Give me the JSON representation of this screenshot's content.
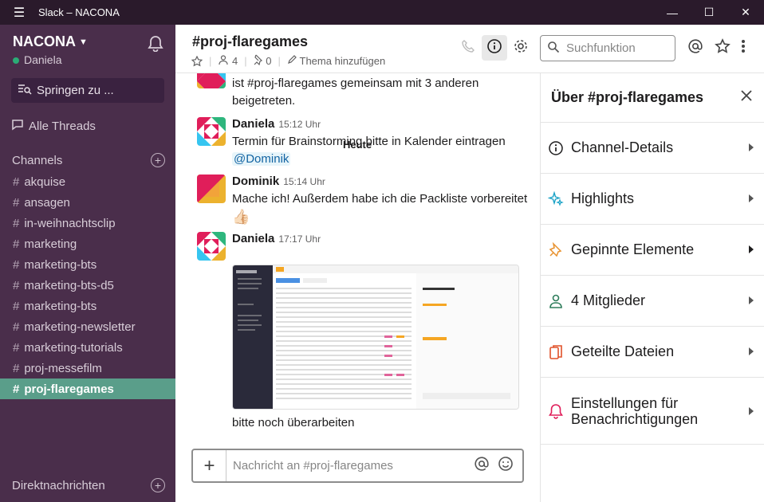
{
  "window": {
    "title": "Slack – NACONA"
  },
  "workspace": {
    "name": "NACONA",
    "user": "Daniela"
  },
  "sidebar": {
    "jump_label": "Springen zu ...",
    "threads_label": "Alle Threads",
    "channels_header": "Channels",
    "channels": [
      {
        "name": "akquise"
      },
      {
        "name": "ansagen"
      },
      {
        "name": "in-weihnachtsclip"
      },
      {
        "name": "marketing"
      },
      {
        "name": "marketing-bts"
      },
      {
        "name": "marketing-bts-d5"
      },
      {
        "name": "marketing-bts"
      },
      {
        "name": "marketing-newsletter"
      },
      {
        "name": "marketing-tutorials"
      },
      {
        "name": "proj-messefilm"
      },
      {
        "name": "proj-flaregames",
        "active": true
      }
    ],
    "dm_header": "Direktnachrichten"
  },
  "channel": {
    "title": "#proj-flaregames",
    "members": "4",
    "pins": "0",
    "topic": "Thema hinzufügen",
    "search_placeholder": "Suchfunktion"
  },
  "messages": {
    "day_divider": "Heute",
    "system_text": "ist #proj-flaregames gemeinsam mit 3 anderen beigetreten.",
    "items": [
      {
        "author": "Daniela",
        "time": "15:12 Uhr",
        "text": "Termin für Brainstorming bitte in Kalender eintragen",
        "mention": "@Dominik"
      },
      {
        "author": "Dominik",
        "time": "15:14 Uhr",
        "text": "Mache ich! Außerdem habe ich die Packliste vorbereitet",
        "reaction": "👍🏻"
      },
      {
        "author": "Daniela",
        "time": "17:17 Uhr",
        "caption": "bitte noch überarbeiten"
      }
    ]
  },
  "composer": {
    "placeholder": "Nachricht an #proj-flaregames"
  },
  "details": {
    "title": "Über #proj-flaregames",
    "items": [
      {
        "label": "Channel-Details",
        "icon": "info-icon",
        "color": "#1d1c1d"
      },
      {
        "label": "Highlights",
        "icon": "sparkle-icon",
        "color": "#1aa2c6"
      },
      {
        "label": "Gepinnte Elemente",
        "icon": "pin-icon",
        "color": "#e8912d"
      },
      {
        "label": "4 Mitglieder",
        "icon": "person-icon",
        "color": "#2e7d5b"
      },
      {
        "label": "Geteilte Dateien",
        "icon": "files-icon",
        "color": "#e0522a"
      },
      {
        "label": "Einstellungen für Benachrichtigungen",
        "icon": "bell-icon",
        "color": "#e01e5a"
      }
    ]
  },
  "colors": {
    "sidebar_bg": "#4a2e4b",
    "active_channel": "#5a9e8a",
    "titlebar": "#2a1a2b"
  }
}
